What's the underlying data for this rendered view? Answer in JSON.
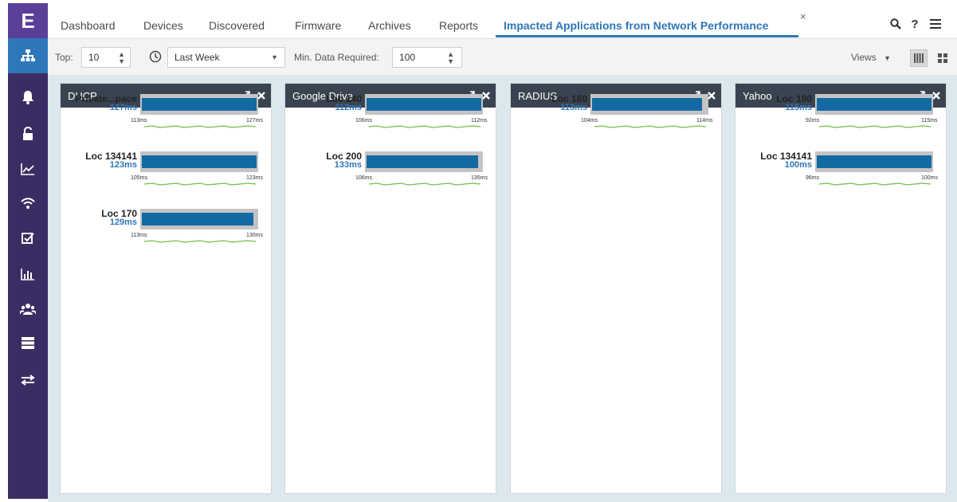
{
  "nav": {
    "logo": "E",
    "items": [
      {
        "icon": "network-tree-icon",
        "active": true
      },
      {
        "icon": "bell-icon",
        "active": false
      },
      {
        "icon": "unlock-icon",
        "active": false
      },
      {
        "icon": "line-chart-icon",
        "active": false
      },
      {
        "icon": "wifi-icon",
        "active": false
      },
      {
        "icon": "checkbox-icon",
        "active": false
      },
      {
        "icon": "bar-chart-icon",
        "active": false
      },
      {
        "icon": "users-icon",
        "active": false
      },
      {
        "icon": "server-icon",
        "active": false
      },
      {
        "icon": "transfer-arrows-icon",
        "active": false
      }
    ]
  },
  "tabs": {
    "items": [
      "Dashboard",
      "Devices",
      "Discovered",
      "Firmware",
      "Archives",
      "Reports",
      "Impacted Applications from Network Performance"
    ],
    "active_index": 6,
    "close_glyph": "×"
  },
  "top_icons": {
    "search": "search-icon",
    "help": "?",
    "menu": "menu-icon"
  },
  "toolbar": {
    "top_label": "Top:",
    "top_value": "10",
    "time_range": "Last Week",
    "min_data_label": "Min. Data Required:",
    "min_data_value": "100",
    "views_label": "Views"
  },
  "accent_color": "#2e77b9",
  "bar_color": "#136aa3",
  "cards": [
    {
      "title": "DHCP",
      "rows": [
        {
          "name": "Private...pace",
          "value_label": "127ms",
          "value": 127,
          "min": 113,
          "max": 127,
          "min_label": "113ms",
          "max_label": "127ms"
        },
        {
          "name": "Loc 134141",
          "value_label": "123ms",
          "value": 123,
          "min": 105,
          "max": 123,
          "min_label": "105ms",
          "max_label": "123ms"
        },
        {
          "name": "Loc 170",
          "value_label": "129ms",
          "value": 129,
          "min": 113,
          "max": 130,
          "min_label": "113ms",
          "max_label": "130ms"
        }
      ]
    },
    {
      "title": "Google Drive",
      "rows": [
        {
          "name": "Loc 140",
          "value_label": "112ms",
          "value": 112,
          "min": 106,
          "max": 112,
          "min_label": "106ms",
          "max_label": "112ms"
        },
        {
          "name": "Loc 200",
          "value_label": "133ms",
          "value": 133,
          "min": 106,
          "max": 135,
          "min_label": "106ms",
          "max_label": "135ms"
        }
      ]
    },
    {
      "title": "RADIUS",
      "rows": [
        {
          "name": "Loc 160",
          "value_label": "113ms",
          "value": 113,
          "min": 104,
          "max": 114,
          "min_label": "104ms",
          "max_label": "114ms"
        }
      ]
    },
    {
      "title": "Yahoo",
      "rows": [
        {
          "name": "Loc 190",
          "value_label": "115ms",
          "value": 115,
          "min": 92,
          "max": 115,
          "min_label": "92ms",
          "max_label": "115ms"
        },
        {
          "name": "Loc 134141",
          "value_label": "100ms",
          "value": 100,
          "min": 96,
          "max": 100,
          "min_label": "96ms",
          "max_label": "100ms"
        }
      ]
    }
  ]
}
